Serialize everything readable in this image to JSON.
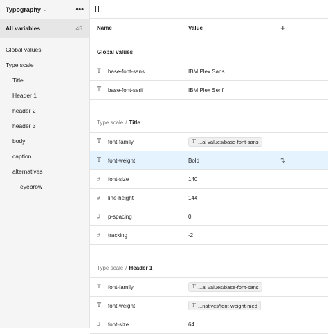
{
  "sidebar": {
    "collection": "Typography",
    "all_label": "All variables",
    "all_count": "45",
    "items": [
      {
        "label": "Global values",
        "level": 0
      },
      {
        "label": "Type scale",
        "level": 0
      },
      {
        "label": "Title",
        "level": 1
      },
      {
        "label": "Header 1",
        "level": 1
      },
      {
        "label": "header 2",
        "level": 1
      },
      {
        "label": "header 3",
        "level": 1
      },
      {
        "label": "body",
        "level": 1
      },
      {
        "label": "caption",
        "level": 1
      },
      {
        "label": "alternatives",
        "level": 1
      },
      {
        "label": "eyebrow",
        "level": 2
      }
    ]
  },
  "table": {
    "col_name": "Name",
    "col_value": "Value",
    "add_symbol": "+"
  },
  "groups": {
    "global": {
      "title": "Global values"
    },
    "title": {
      "prefix": "Type scale",
      "sep": "/",
      "name": "Title"
    },
    "header1": {
      "prefix": "Type scale",
      "sep": "/",
      "name": "Header 1"
    }
  },
  "rows": {
    "global": [
      {
        "icon": "T",
        "name": "base-font-sans",
        "value": "IBM Plex Sans"
      },
      {
        "icon": "T",
        "name": "base-font-serif",
        "value": "IBM Plex Serif"
      }
    ],
    "title": [
      {
        "icon": "T",
        "name": "font-family",
        "alias": "...al values/base-font-sans"
      },
      {
        "icon": "T",
        "name": "font-weight",
        "value": "Bold"
      },
      {
        "icon": "#",
        "name": "font-size",
        "value": "140"
      },
      {
        "icon": "#",
        "name": "line-height",
        "value": "144"
      },
      {
        "icon": "#",
        "name": "p-spacing",
        "value": "0"
      },
      {
        "icon": "#",
        "name": "tracking",
        "value": "-2"
      }
    ],
    "header1": [
      {
        "icon": "T",
        "name": "font-family",
        "alias": "...al values/base-font-sans"
      },
      {
        "icon": "T",
        "name": "font-weight",
        "alias": "...natives/font-weight-med"
      },
      {
        "icon": "#",
        "name": "font-size",
        "value": "64"
      }
    ]
  },
  "icons": {
    "more": "•••",
    "chevron": "⌄",
    "adjust": "⇅"
  }
}
